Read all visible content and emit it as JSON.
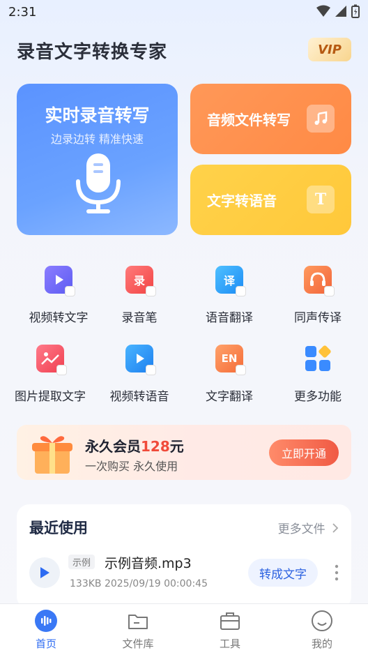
{
  "status_bar": {
    "time": "2:31"
  },
  "header": {
    "title": "录音文字转换专家",
    "vip_label": "VIP"
  },
  "cards": {
    "realtime": {
      "title": "实时录音转写",
      "subtitle": "边录边转 精准快速"
    },
    "audio": {
      "label": "音频文件转写",
      "icon": "music-note-icon"
    },
    "tts": {
      "label": "文字转语音",
      "icon": "text-t-icon",
      "icon_text": "T"
    }
  },
  "tools": [
    {
      "label": "视频转文字",
      "icon": "video-to-text-icon",
      "color": "#7a6bff"
    },
    {
      "label": "录音笔",
      "icon": "recorder-icon",
      "color": "#ff5e5e",
      "icon_text": "录"
    },
    {
      "label": "语音翻译",
      "icon": "voice-translate-icon",
      "color": "#2ea8ff",
      "icon_text": "译"
    },
    {
      "label": "同声传译",
      "icon": "headset-icon",
      "color": "#ff7a4a"
    },
    {
      "label": "图片提取文字",
      "icon": "image-text-icon",
      "color": "#ff5a6a"
    },
    {
      "label": "视频转语音",
      "icon": "video-to-voice-icon",
      "color": "#2c9bff"
    },
    {
      "label": "文字翻译",
      "icon": "text-translate-icon",
      "color": "#ff8a4a",
      "icon_text": "EN"
    },
    {
      "label": "更多功能",
      "icon": "more-features-icon",
      "color": "#3a8bff"
    }
  ],
  "promo": {
    "title_prefix": "永久会员",
    "price": "128",
    "title_suffix": "元",
    "subtitle": "一次购买 永久使用",
    "button": "立即开通"
  },
  "recent": {
    "heading": "最近使用",
    "more": "更多文件",
    "item": {
      "tag": "示例",
      "name": "示例音频.mp3",
      "meta": "133KB 2025/09/19 00:00:45",
      "action": "转成文字"
    }
  },
  "tabs": [
    {
      "label": "首页",
      "icon": "home-audio-icon",
      "active": true
    },
    {
      "label": "文件库",
      "icon": "folder-icon",
      "active": false
    },
    {
      "label": "工具",
      "icon": "toolbox-icon",
      "active": false
    },
    {
      "label": "我的",
      "icon": "profile-smile-icon",
      "active": false
    }
  ],
  "colors": {
    "accent": "#2d6bf2",
    "realtime_card": "#5b93ff",
    "audio_card": "#ff8a45",
    "tts_card": "#ffc83a",
    "promo_price": "#f04a3a"
  }
}
